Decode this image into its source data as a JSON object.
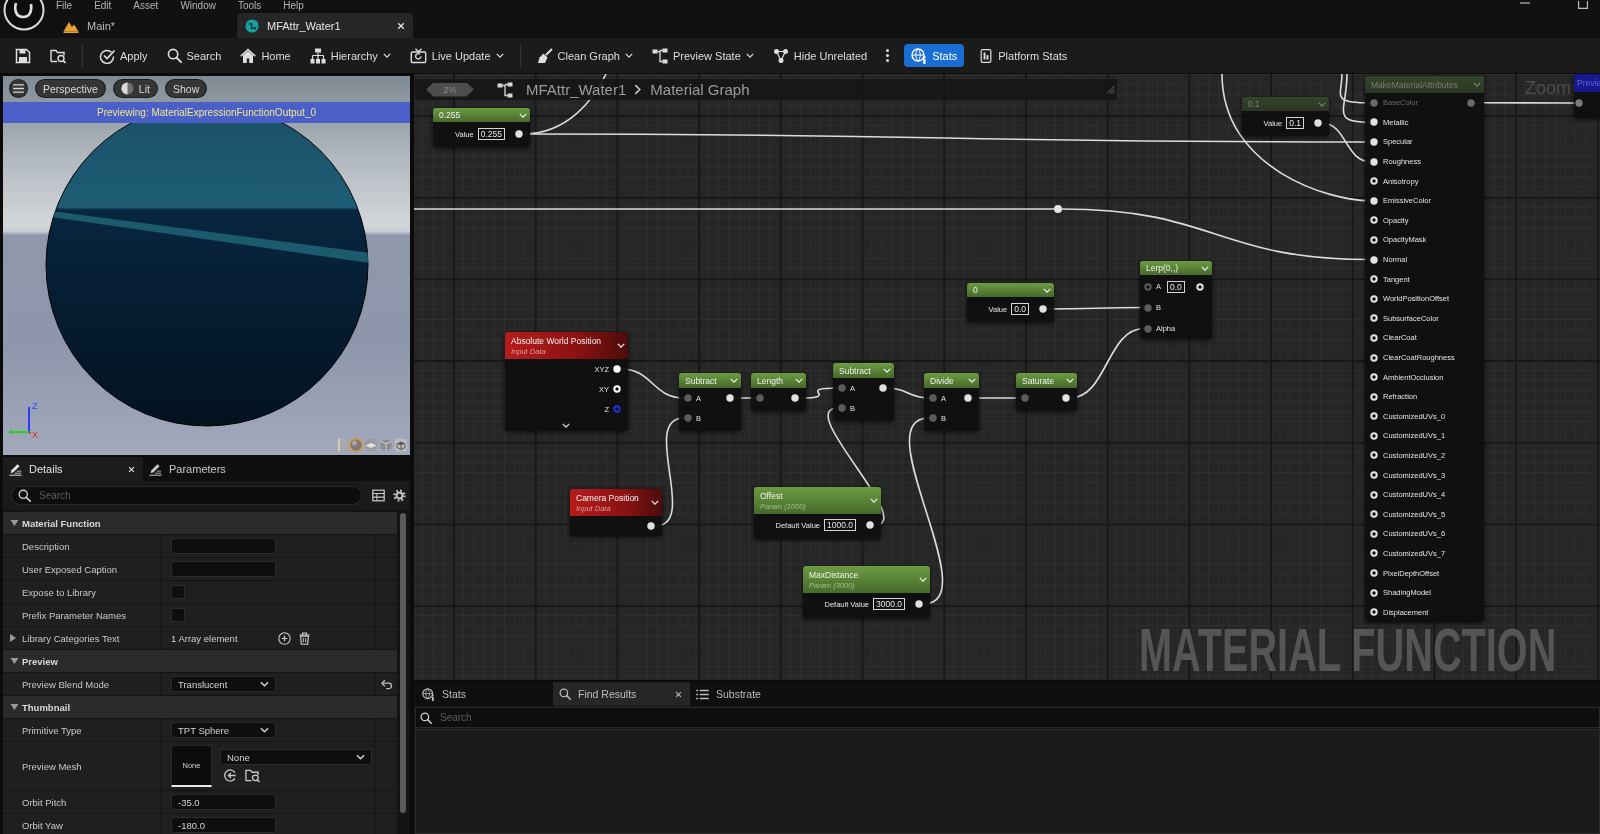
{
  "menu": [
    "File",
    "Edit",
    "Asset",
    "Window",
    "Tools",
    "Help"
  ],
  "window_controls": [
    {
      "kind": "minimize"
    },
    {
      "kind": "maximize"
    }
  ],
  "document_tabs": [
    {
      "label": "Main*",
      "kind": "level",
      "selected": false
    },
    {
      "label": "MFAttr_Water1",
      "kind": "function",
      "selected": true
    }
  ],
  "toolbar": {
    "groups": [
      [
        {
          "kind": "save",
          "active": false
        },
        {
          "kind": "browse",
          "active": false
        }
      ],
      [
        {
          "kind": "apply",
          "label": "Apply",
          "dropdown": false,
          "active": false
        },
        {
          "kind": "search",
          "label": "Search",
          "dropdown": false,
          "active": false
        },
        {
          "kind": "home",
          "label": "Home",
          "dropdown": false,
          "active": false
        },
        {
          "kind": "hierarchy",
          "label": "Hierarchy",
          "dropdown": true,
          "active": false
        },
        {
          "kind": "live_update",
          "label": "Live Update",
          "dropdown": true,
          "active": false
        }
      ],
      [
        {
          "kind": "clean",
          "label": "Clean Graph",
          "dropdown": true,
          "active": false
        },
        {
          "kind": "preview_state",
          "label": "Preview State",
          "dropdown": true,
          "active": false
        },
        {
          "kind": "hide_unrelated",
          "label": "Hide Unrelated",
          "dropdown": false,
          "active": false
        },
        {
          "kind": "more",
          "active": false
        },
        {
          "kind": "stats",
          "label": "Stats",
          "dropdown": false,
          "active": true
        },
        {
          "kind": "platform_stats",
          "label": "Platform Stats",
          "dropdown": false,
          "active": false
        }
      ]
    ]
  },
  "viewport": {
    "controls": [
      {
        "kind": "menu"
      },
      {
        "kind": "view",
        "label": "Perspective"
      },
      {
        "kind": "lit",
        "label": "Lit"
      },
      {
        "kind": "show",
        "label": "Show"
      }
    ],
    "banner": "Previewing: MaterialExpressionFunctionOutput_0",
    "axes": {
      "z": "Z",
      "x": "X"
    },
    "shapes": [
      {
        "kind": "cylinder",
        "selected": false
      },
      {
        "kind": "sphere",
        "selected": true
      },
      {
        "kind": "plane",
        "selected": false
      },
      {
        "kind": "cube",
        "selected": false
      },
      {
        "kind": "mesh",
        "selected": false
      }
    ]
  },
  "details": {
    "tabs": [
      {
        "label": "Details",
        "selected": true,
        "closable": true
      },
      {
        "label": "Parameters",
        "selected": false,
        "closable": false
      }
    ],
    "search": {
      "placeholder": "Search"
    },
    "sections": [
      {
        "title": "Material Function",
        "expanded": true,
        "rows": [
          {
            "label": "Description",
            "kind": "text",
            "modified": false
          },
          {
            "label": "User Exposed Caption",
            "kind": "text",
            "modified": false
          },
          {
            "label": "Expose to Library",
            "kind": "checkbox",
            "checked": false,
            "modified": false
          },
          {
            "label": "Prefix Parameter Names",
            "kind": "checkbox",
            "checked": false,
            "modified": false
          },
          {
            "label": "Library Categories Text",
            "kind": "array",
            "value": "1 Array element",
            "expanded": false,
            "modified": false
          }
        ]
      },
      {
        "title": "Preview",
        "expanded": true,
        "rows": [
          {
            "label": "Preview Blend Mode",
            "kind": "dropdown",
            "value": "Translucent",
            "modified": true
          }
        ]
      },
      {
        "title": "Thumbnail",
        "expanded": true,
        "rows": [
          {
            "label": "Primitive Type",
            "kind": "dropdown",
            "value": "TPT Sphere",
            "modified": false
          },
          {
            "label": "Preview Mesh",
            "kind": "asset",
            "thumbnail": "None",
            "value": "None",
            "modified": false
          },
          {
            "label": "Orbit Pitch",
            "kind": "number",
            "value": "-35.0",
            "modified": false
          },
          {
            "label": "Orbit Yaw",
            "kind": "number",
            "value": "-180.0",
            "modified": false
          }
        ]
      }
    ]
  },
  "graph": {
    "history": "2%",
    "path": [
      {
        "label": "MFAttr_Water1"
      },
      {
        "label": "Material Graph"
      }
    ],
    "zoom_label": "Zoom",
    "watermark": "MATERIAL FUNCTION",
    "nodes": [
      {
        "kind": "constant",
        "title": "0.255",
        "dimmed": false,
        "field_label": "Value",
        "value": "0.255",
        "output": {
          "connected": true
        }
      },
      {
        "kind": "constant",
        "title": "0.1",
        "dimmed": true,
        "field_label": "Value",
        "value": "0.1",
        "output": {
          "connected": true
        }
      },
      {
        "kind": "attributes",
        "title": "MakeMaterialAttributes",
        "dimmed": true,
        "inputs": [
          {
            "label": "BaseColor",
            "connected": true,
            "dimmed": true
          },
          {
            "label": "Metallic",
            "connected": true,
            "dimmed": false
          },
          {
            "label": "Specular",
            "connected": true,
            "dimmed": false
          },
          {
            "label": "Roughness",
            "connected": true,
            "dimmed": false
          },
          {
            "label": "Anisotropy",
            "connected": false,
            "dimmed": false
          },
          {
            "label": "EmissiveColor",
            "connected": true,
            "dimmed": false
          },
          {
            "label": "Opacity",
            "connected": false,
            "dimmed": false
          },
          {
            "label": "OpacityMask",
            "connected": false,
            "dimmed": false
          },
          {
            "label": "Normal",
            "connected": true,
            "dimmed": false
          },
          {
            "label": "Tangent",
            "connected": false,
            "dimmed": false
          },
          {
            "label": "WorldPositionOffset",
            "connected": false,
            "dimmed": false
          },
          {
            "label": "SubsurfaceColor",
            "connected": false,
            "dimmed": false
          },
          {
            "label": "ClearCoat",
            "connected": false,
            "dimmed": false
          },
          {
            "label": "ClearCoatRoughness",
            "connected": false,
            "dimmed": false
          },
          {
            "label": "AmbientOcclusion",
            "connected": false,
            "dimmed": false
          },
          {
            "label": "Refraction",
            "connected": false,
            "dimmed": false
          },
          {
            "label": "CustomizedUVs_0",
            "connected": false,
            "dimmed": false
          },
          {
            "label": "CustomizedUVs_1",
            "connected": false,
            "dimmed": false
          },
          {
            "label": "CustomizedUVs_2",
            "connected": false,
            "dimmed": false
          },
          {
            "label": "CustomizedUVs_3",
            "connected": false,
            "dimmed": false
          },
          {
            "label": "CustomizedUVs_4",
            "connected": false,
            "dimmed": false
          },
          {
            "label": "CustomizedUVs_5",
            "connected": false,
            "dimmed": false
          },
          {
            "label": "CustomizedUVs_6",
            "connected": false,
            "dimmed": false
          },
          {
            "label": "CustomizedUVs_7",
            "connected": false,
            "dimmed": false
          },
          {
            "label": "PixelDepthOffset",
            "connected": false,
            "dimmed": false
          },
          {
            "label": "ShadingModel",
            "connected": false,
            "dimmed": false
          },
          {
            "label": "Displacement",
            "connected": false,
            "dimmed": false
          }
        ],
        "output": {
          "connected": true
        }
      },
      {
        "kind": "result",
        "title": "Previe",
        "input": {
          "connected": true
        }
      },
      {
        "kind": "reroute"
      },
      {
        "kind": "constant",
        "title": "0",
        "dimmed": false,
        "field_label": "Value",
        "value": "0.0",
        "output": {
          "connected": true
        }
      },
      {
        "kind": "lerp",
        "title": "Lerp(0,,)",
        "inputs": [
          {
            "label": "A",
            "value": "0.0",
            "connected": false
          },
          {
            "label": "B",
            "connected": true
          },
          {
            "label": "Alpha",
            "connected": true
          }
        ],
        "output": {
          "connected": false
        }
      },
      {
        "kind": "input",
        "title": "Absolute World Position",
        "subtitle": "Input Data",
        "advanced": true,
        "outputs": [
          {
            "label": "XYZ",
            "connected": true,
            "color": "#ffffff"
          },
          {
            "label": "XY",
            "connected": false,
            "color": "#ffffff"
          },
          {
            "label": "Z",
            "connected": false,
            "color": "#2430e0"
          }
        ]
      },
      {
        "kind": "math",
        "title": "Subtract",
        "inputs": [
          {
            "label": "A",
            "connected": true
          },
          {
            "label": "B",
            "connected": true
          }
        ],
        "output": {
          "connected": true
        }
      },
      {
        "kind": "math",
        "title": "Length",
        "inputs": [
          {
            "connected": true
          }
        ],
        "output": {
          "connected": true
        }
      },
      {
        "kind": "math",
        "title": "Subtract",
        "inputs": [
          {
            "label": "A",
            "connected": true
          },
          {
            "label": "B",
            "connected": true
          }
        ],
        "output": {
          "connected": true
        }
      },
      {
        "kind": "math",
        "title": "Divide",
        "inputs": [
          {
            "label": "A",
            "connected": true
          },
          {
            "label": "B",
            "connected": true
          }
        ],
        "output": {
          "connected": true
        }
      },
      {
        "kind": "math",
        "title": "Saturate",
        "inputs": [
          {
            "connected": true
          }
        ],
        "output": {
          "connected": true
        }
      },
      {
        "kind": "input",
        "title": "Camera Position",
        "subtitle": "Input Data",
        "outputs": [
          {
            "connected": true
          }
        ]
      },
      {
        "kind": "param",
        "title": "Offest",
        "subtitle": "Param (1000)",
        "field_label": "Default Value",
        "value": "1000.0",
        "output": {
          "connected": true
        }
      },
      {
        "kind": "param",
        "title": "MaxDistance",
        "subtitle": "Param (3000)",
        "field_label": "Default Value",
        "value": "3000.0",
        "output": {
          "connected": true
        }
      }
    ]
  },
  "bottom_panel": {
    "tabs": [
      {
        "label": "Stats",
        "kind": "stats",
        "selected": false,
        "closable": false
      },
      {
        "label": "Find Results",
        "kind": "search",
        "selected": true,
        "closable": true
      },
      {
        "label": "Substrate",
        "kind": "list",
        "selected": false,
        "closable": false
      }
    ],
    "search": {
      "placeholder": "Search"
    }
  }
}
